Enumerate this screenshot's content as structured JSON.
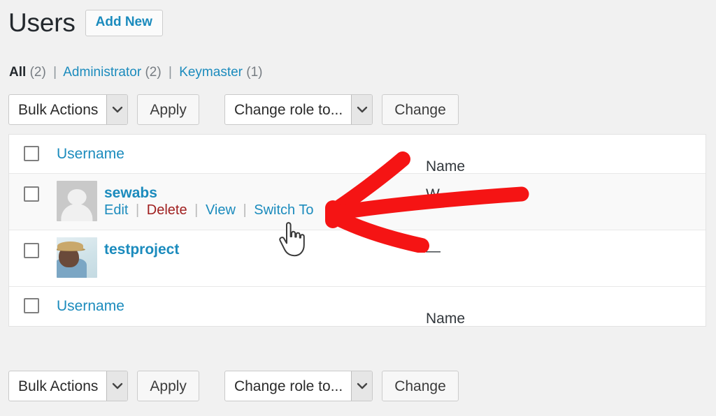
{
  "header": {
    "title": "Users",
    "add_new_label": "Add New"
  },
  "filters": {
    "items": [
      {
        "label": "All",
        "count": "(2)",
        "current": true
      },
      {
        "label": "Administrator",
        "count": "(2)",
        "current": false
      },
      {
        "label": "Keymaster",
        "count": "(1)",
        "current": false
      }
    ],
    "separator": "|"
  },
  "toolbar_top": {
    "bulk_actions_value": "Bulk Actions",
    "apply_label": "Apply",
    "change_role_value": "Change role to...",
    "change_label": "Change"
  },
  "toolbar_bottom": {
    "bulk_actions_value": "Bulk Actions",
    "apply_label": "Apply",
    "change_role_value": "Change role to...",
    "change_label": "Change"
  },
  "table": {
    "columns": {
      "username": "Username",
      "name": "Name"
    },
    "rows": [
      {
        "username": "sewabs",
        "name": "W",
        "avatar": "mystery",
        "actions": {
          "edit": "Edit",
          "delete": "Delete",
          "view": "View",
          "switch_to": "Switch To"
        }
      },
      {
        "username": "testproject",
        "name": "—",
        "avatar": "photo"
      }
    ]
  },
  "annotation": {
    "arrow_color": "#f51414",
    "points_to": "Switch To"
  },
  "colors": {
    "link": "#1b8bbd",
    "delete_link": "#a02020",
    "page_background": "#f1f1f1",
    "table_background": "#ffffff",
    "striped_row": "#f9f9f9",
    "text": "#32373c"
  }
}
